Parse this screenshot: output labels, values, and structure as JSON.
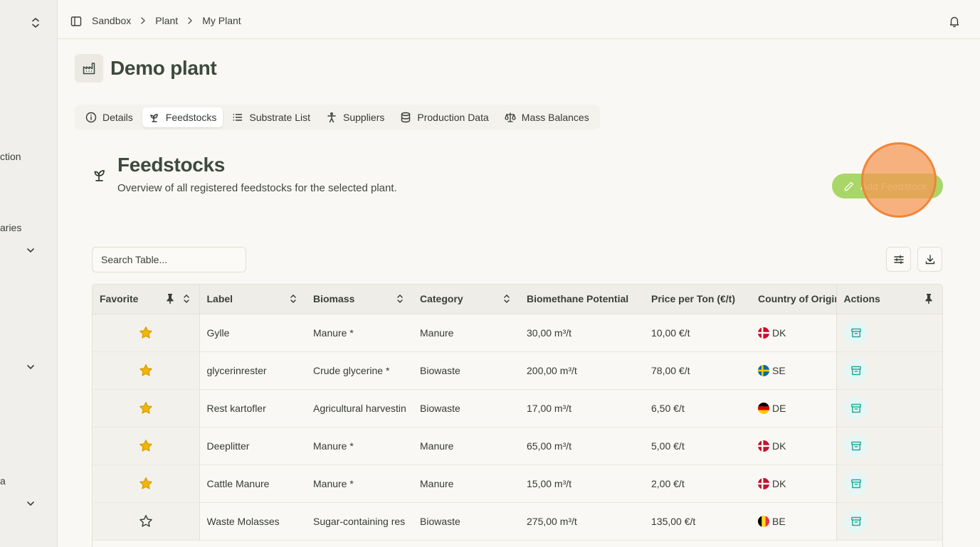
{
  "sidebar": {
    "fragments": [
      "ction",
      "aries",
      "a"
    ]
  },
  "breadcrumb": [
    "Sandbox",
    "Plant",
    "My Plant"
  ],
  "page": {
    "title": "Demo plant"
  },
  "tabs": [
    {
      "label": "Details",
      "icon": "info-icon",
      "active": false
    },
    {
      "label": "Feedstocks",
      "icon": "sprout-icon",
      "active": true
    },
    {
      "label": "Substrate List",
      "icon": "list-icon",
      "active": false
    },
    {
      "label": "Suppliers",
      "icon": "person-icon",
      "active": false
    },
    {
      "label": "Production Data",
      "icon": "database-icon",
      "active": false
    },
    {
      "label": "Mass Balances",
      "icon": "scale-icon",
      "active": false
    }
  ],
  "section": {
    "title": "Feedstocks",
    "subtitle": "Overview of all registered feedstocks for the selected plant."
  },
  "add_button": {
    "label": "Add Feedstock"
  },
  "search": {
    "placeholder": "Search Table..."
  },
  "table": {
    "columns": [
      "Favorite",
      "Label",
      "Biomass",
      "Category",
      "Biomethane Potential",
      "Price per Ton (€/t)",
      "Country of Origin",
      "Actions"
    ],
    "rows": [
      {
        "favorite": true,
        "label": "Gylle",
        "biomass": "Manure *",
        "category": "Manure",
        "potential": "30,00 m³/t",
        "price": "10,00 €/t",
        "country": "DK"
      },
      {
        "favorite": true,
        "label": "glycerinrester",
        "biomass": "Crude glycerine *",
        "category": "Biowaste",
        "potential": "200,00 m³/t",
        "price": "78,00 €/t",
        "country": "SE"
      },
      {
        "favorite": true,
        "label": "Rest kartofler",
        "biomass": "Agricultural harvesting",
        "category": "Biowaste",
        "potential": "17,00 m³/t",
        "price": "6,50 €/t",
        "country": "DE"
      },
      {
        "favorite": true,
        "label": "Deeplitter",
        "biomass": "Manure *",
        "category": "Manure",
        "potential": "65,00 m³/t",
        "price": "5,00 €/t",
        "country": "DK"
      },
      {
        "favorite": true,
        "label": "Cattle Manure",
        "biomass": "Manure *",
        "category": "Manure",
        "potential": "15,00 m³/t",
        "price": "2,00 €/t",
        "country": "DK"
      },
      {
        "favorite": false,
        "label": "Waste Molasses",
        "biomass": "Sugar-containing residue",
        "category": "Biowaste",
        "potential": "275,00 m³/t",
        "price": "135,00 €/t",
        "country": "BE"
      }
    ]
  },
  "colors": {
    "accent_green": "#a9d668",
    "star_gold": "#f2b705",
    "archive_teal": "#2aa79a",
    "heading": "#3d4a3d",
    "click_ring": "#f59650"
  }
}
